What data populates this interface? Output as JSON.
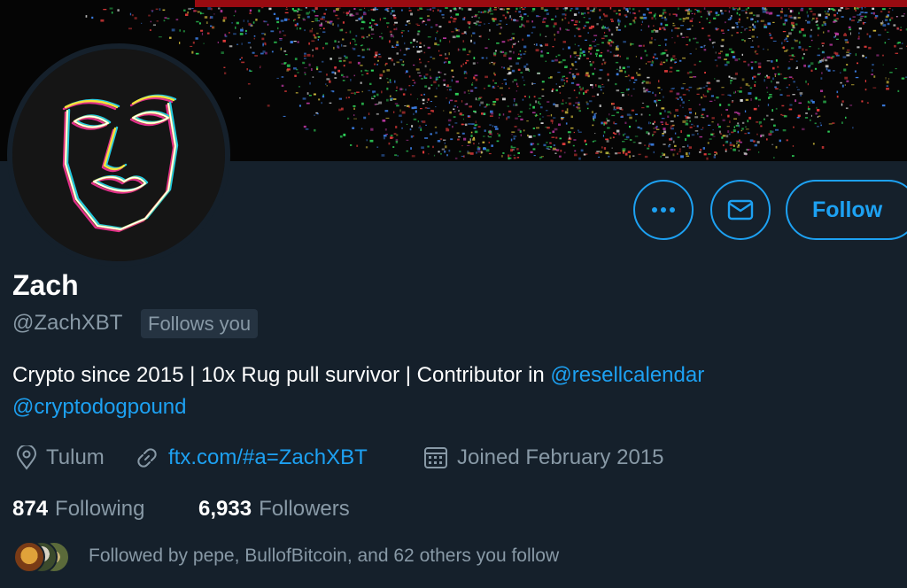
{
  "profile": {
    "name": "Zach",
    "handle": "@ZachXBT",
    "follows_you_badge": "Follows you",
    "bio_text": "Crypto since 2015 | 10x Rug pull survivor | Contributor in ",
    "bio_mention_1": "@resellcalendar",
    "bio_mention_2": "@cryptodogpound",
    "location": "Tulum",
    "website": "ftx.com/#a=ZachXBT",
    "joined": "Joined February 2015",
    "following_count": "874",
    "following_label": "Following",
    "followers_count": "6,933",
    "followers_label": "Followers",
    "followed_by": "Followed by pepe, BullofBitcoin, and 62 others you follow"
  },
  "actions": {
    "more_icon": "more-dots-icon",
    "message_icon": "envelope-icon",
    "follow_label": "Follow"
  },
  "icons": {
    "location": "location-pin-icon",
    "website": "link-icon",
    "joined": "calendar-icon"
  },
  "colors": {
    "background": "#15202b",
    "accent": "#1da1f2",
    "secondary_text": "#8899a6",
    "badge_bg": "#253341"
  }
}
